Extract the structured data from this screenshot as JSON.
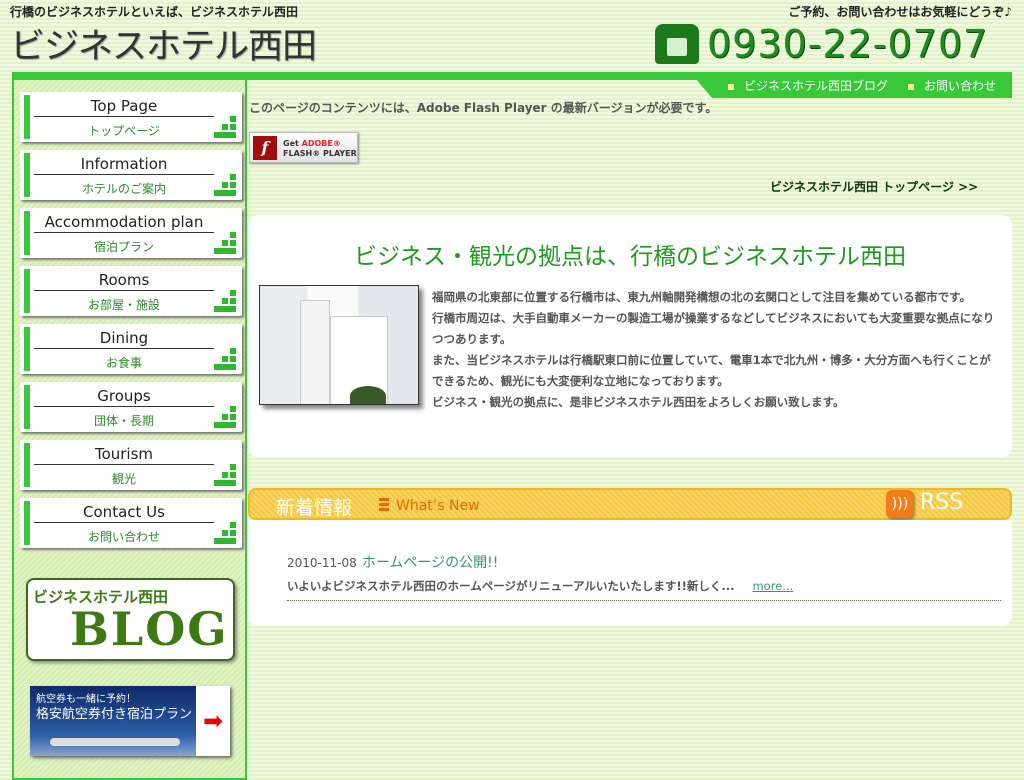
{
  "header": {
    "tagline": "行橋のビジネスホテルといえば、ビジネスホテル西田",
    "logo": "ビジネスホテル西田",
    "reserve": "ご予約、お問い合わせはお気軽にどうぞ♪",
    "phone": "0930-22-0707",
    "phone_icon": "telephone-icon"
  },
  "topnav": [
    {
      "label": "ビジネスホテル西田ブログ"
    },
    {
      "label": "お問い合わせ"
    }
  ],
  "sidebar": {
    "items": [
      {
        "en": "Top Page",
        "jp": "トップページ"
      },
      {
        "en": "Information",
        "jp": "ホテルのご案内"
      },
      {
        "en": "Accommodation plan",
        "jp": "宿泊プラン"
      },
      {
        "en": "Rooms",
        "jp": "お部屋・施設"
      },
      {
        "en": "Dining",
        "jp": "お食事"
      },
      {
        "en": "Groups",
        "jp": "団体・長期"
      },
      {
        "en": "Tourism",
        "jp": "観光"
      },
      {
        "en": "Contact Us",
        "jp": "お問い合わせ"
      }
    ],
    "blog": {
      "line1": "ビジネスホテル西田",
      "line2": "BLOG"
    },
    "air": {
      "line1": "航空券も一緒に予約！",
      "line2": "格安航空券付き宿泊プラン",
      "arrow": "➡"
    }
  },
  "main": {
    "flash_msg": "このページのコンテンツには、Adobe Flash Player の最新バージョンが必要です。",
    "flash_btn": {
      "get": "Get",
      "adobe": "ADOBE®",
      "player": "FLASH® PLAYER"
    },
    "top_link": "ビジネスホテル西田 トップページ >>",
    "intro_title": "ビジネス・観光の拠点は、行橋のビジネスホテル西田",
    "intro_lines": [
      "福岡県の北東部に位置する行橋市は、東九州軸開発構想の北の玄関口として注目を集めている都市です。",
      "行橋市周辺は、大手自動車メーカーの製造工場が操業するなどしてビジネスにおいても大変重要な拠点になりつつあります。",
      "また、当ビジネスホテルは行橋駅東口前に位置していて、電車1本で北九州・博多・大分方面へも行くことができるため、観光にも大変便利な立地になっております。",
      "ビジネス・観光の拠点に、是非ビジネスホテル西田をよろしくお願い致します。"
    ],
    "news_head": {
      "jp": "新着情報",
      "en": "What’s New",
      "rss": "RSS"
    },
    "news": [
      {
        "date": "2010-11-08",
        "title": "ホームページの公開!!",
        "excerpt": "いよいよビジネスホテル西田のホームページがリニューアルいたいたします!!新しく...",
        "more": "more..."
      }
    ]
  },
  "colors": {
    "accent": "#39c83a",
    "news_bar": "#f5c740",
    "title_green": "#1e9a1e"
  }
}
